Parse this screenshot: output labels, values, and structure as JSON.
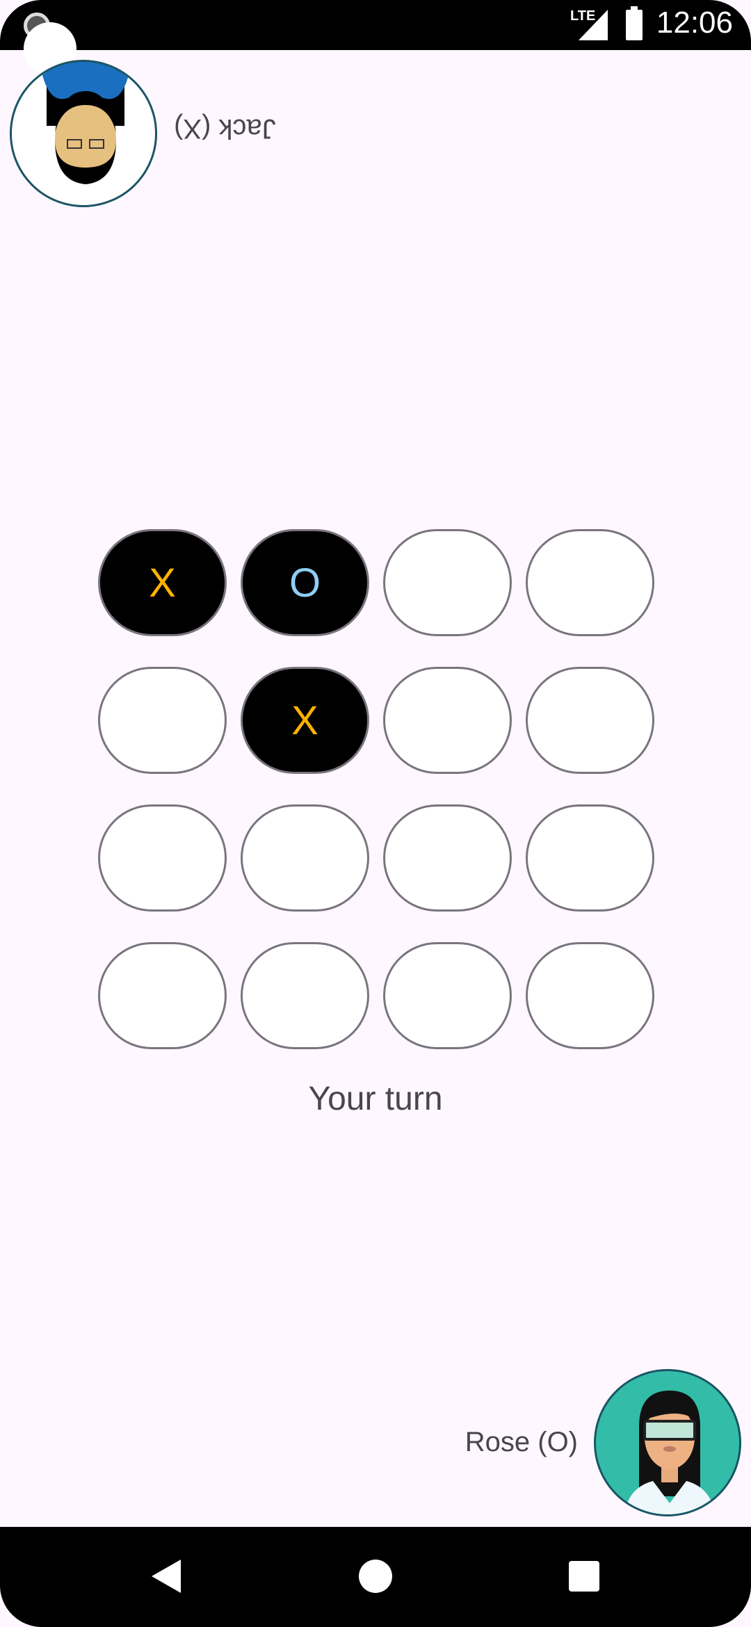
{
  "status_bar": {
    "time": "12:06",
    "network": "LTE"
  },
  "players": {
    "top": {
      "name": "Jack (X)",
      "avatar": "man-avatar"
    },
    "bottom": {
      "name": "Rose (O)",
      "avatar": "woman-avatar"
    }
  },
  "board": {
    "rows": [
      [
        "X",
        "O",
        "",
        ""
      ],
      [
        "",
        "X",
        "",
        ""
      ],
      [
        "",
        "",
        "",
        ""
      ],
      [
        "",
        "",
        "",
        ""
      ]
    ]
  },
  "colors": {
    "x": "#ffb300",
    "o": "#8ecdf5",
    "cell_border": "#79747e"
  },
  "status_text": "Your turn"
}
